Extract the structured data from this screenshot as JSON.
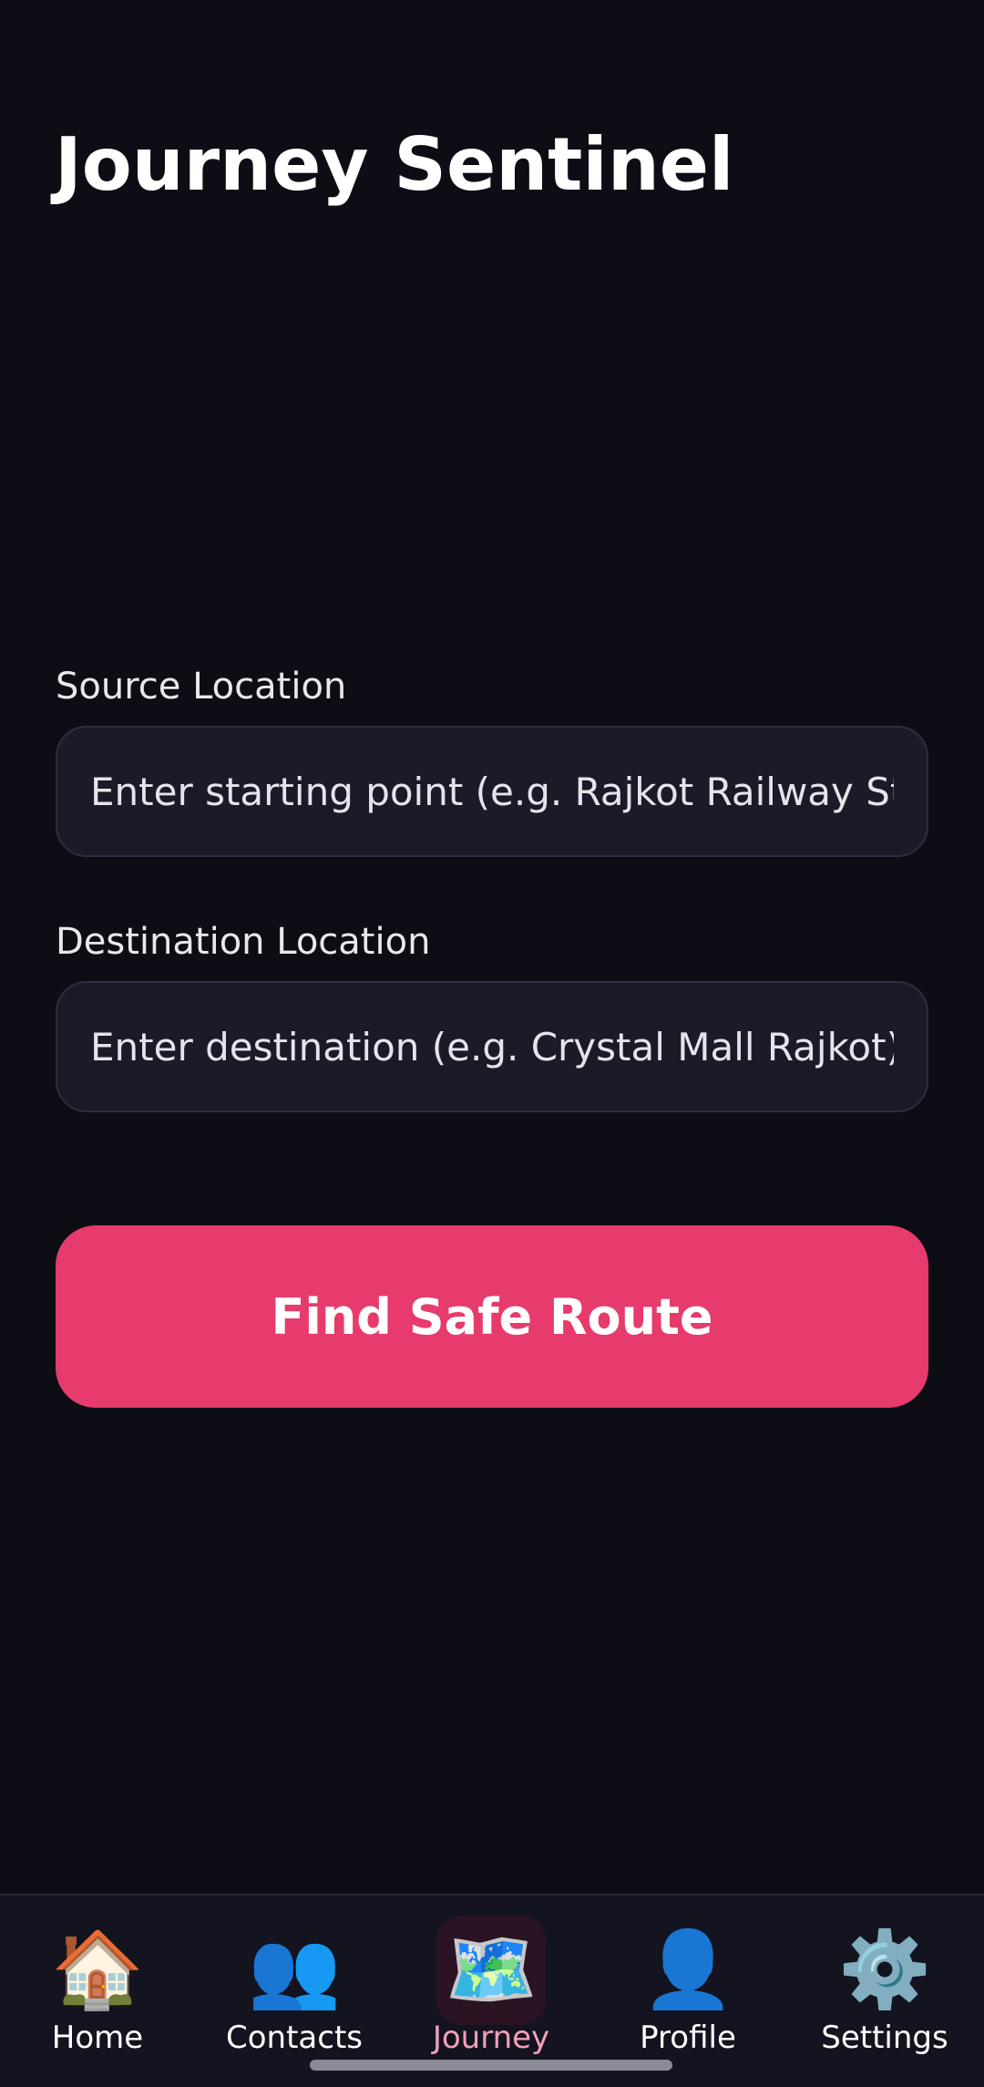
{
  "header": {
    "title": "Journey Sentinel"
  },
  "form": {
    "source": {
      "label": "Source Location",
      "placeholder": "Enter starting point (e.g. Rajkot Railway St",
      "value": ""
    },
    "destination": {
      "label": "Destination Location",
      "placeholder": "Enter destination (e.g. Crystal Mall Rajkot)",
      "value": ""
    },
    "submit_label": "Find Safe Route"
  },
  "tabbar": {
    "active": "Journey",
    "items": [
      {
        "label": "Home",
        "icon": "house-icon",
        "glyph": "🏠"
      },
      {
        "label": "Contacts",
        "icon": "people-icon",
        "glyph": "👥"
      },
      {
        "label": "Journey",
        "icon": "map-icon",
        "glyph": "🗺️"
      },
      {
        "label": "Profile",
        "icon": "person-icon",
        "glyph": "👤"
      },
      {
        "label": "Settings",
        "icon": "gear-icon",
        "glyph": "⚙️"
      }
    ]
  },
  "colors": {
    "background": "#0d0d16",
    "accent": "#e63b6c",
    "input_background": "#1a1a28",
    "active_tab_label": "#f2a0b8"
  }
}
